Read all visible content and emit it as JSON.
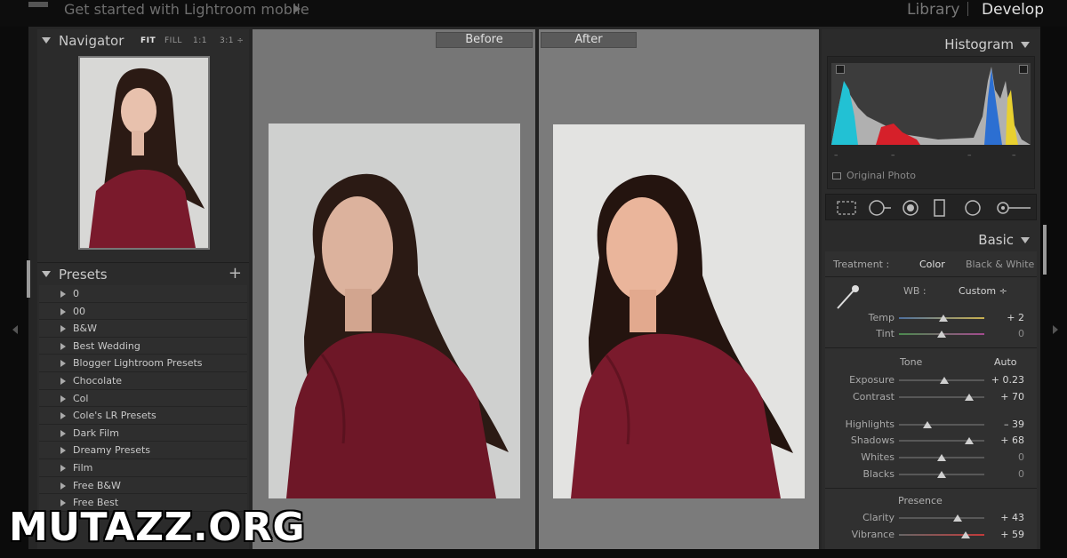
{
  "topbar": {
    "title": "Get started with Lightroom mobile",
    "modules": {
      "library": "Library",
      "develop": "Develop"
    }
  },
  "navigator": {
    "title": "Navigator",
    "zoom": [
      "FIT",
      "FILL",
      "1:1",
      "3:1 ÷"
    ],
    "active_zoom": "FIT"
  },
  "presets": {
    "title": "Presets",
    "add_icon": "+",
    "items": [
      "0",
      "00",
      "B&W",
      "Best Wedding",
      "Blogger Lightroom Presets",
      "Chocolate",
      "Col",
      "Cole's LR Presets",
      "Dark Film",
      "Dreamy Presets",
      "Film",
      "Free B&W",
      "Free Best"
    ]
  },
  "compare": {
    "before_label": "Before",
    "after_label": "After"
  },
  "histogram": {
    "title": "Histogram",
    "original_photo_label": "Original Photo",
    "tick_marks": [
      "–",
      "–",
      "–",
      "–"
    ]
  },
  "basic": {
    "title": "Basic",
    "treatment_label": "Treatment :",
    "treatment_options": [
      "Color",
      "Black & White"
    ],
    "treatment_selected": "Color",
    "wb_label": "WB :",
    "wb_value": "Custom ÷",
    "tone_label": "Tone",
    "auto_label": "Auto",
    "presence_label": "Presence",
    "sliders": {
      "temp": {
        "label": "Temp",
        "display": "+ 2",
        "pos": 0.52
      },
      "tint": {
        "label": "Tint",
        "display": "0",
        "pos": 0.5
      },
      "exposure": {
        "label": "Exposure",
        "display": "+ 0.23",
        "pos": 0.53
      },
      "contrast": {
        "label": "Contrast",
        "display": "+ 70",
        "pos": 0.82
      },
      "highlights": {
        "label": "Highlights",
        "display": "– 39",
        "pos": 0.33
      },
      "shadows": {
        "label": "Shadows",
        "display": "+ 68",
        "pos": 0.82
      },
      "whites": {
        "label": "Whites",
        "display": "0",
        "pos": 0.5
      },
      "blacks": {
        "label": "Blacks",
        "display": "0",
        "pos": 0.5
      },
      "clarity": {
        "label": "Clarity",
        "display": "+ 43",
        "pos": 0.69
      },
      "vibrance": {
        "label": "Vibrance",
        "display": "+ 59",
        "pos": 0.78
      }
    }
  },
  "watermark": "MUTAZZ.ORG",
  "colors": {
    "panel_bg": "#2b2b2b",
    "photo_bg_before": "#cfd0cf",
    "photo_bg_after": "#e3e3e1",
    "hoodie": "#7a1a2c",
    "hair": "#2b1a14"
  },
  "icons": [
    "crop-icon",
    "spot-removal-icon",
    "red-eye-icon",
    "graduated-filter-icon",
    "radial-filter-icon",
    "adjustment-brush-icon",
    "eyedropper-icon"
  ]
}
